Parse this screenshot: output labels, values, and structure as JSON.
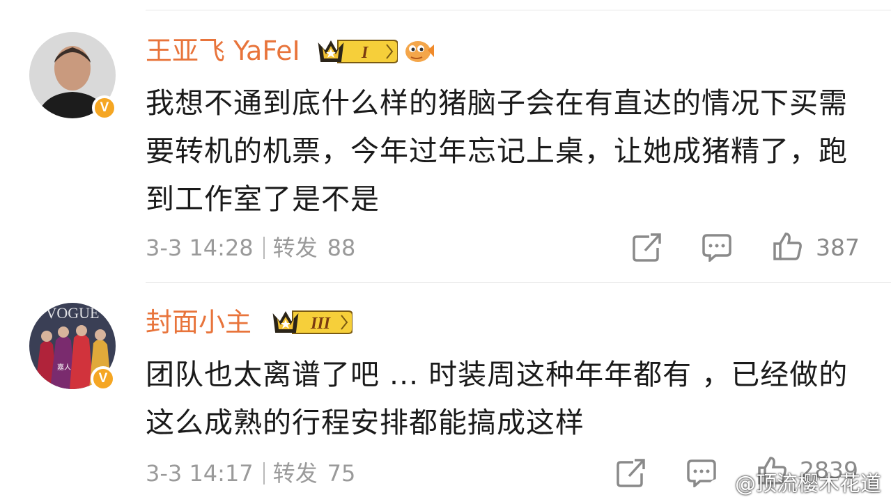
{
  "comments": [
    {
      "username": "王亚飞 YaFeI",
      "level": "I",
      "text": "我想不通到底什么样的猪脑子会在有直达的情况下买需要转机的机票，今年过年忘记上桌，让她成猪精了，跑到工作室了是不是",
      "time": "3-3 14:28",
      "repost_label": "转发",
      "repost_count": "88",
      "like_count": "387"
    },
    {
      "username": "封面小主",
      "level": "III",
      "text": "团队也太离谱了吧 ... 时装周这种年年都有 ，已经做的这么成熟的行程安排都能搞成这样",
      "time": "3-3 14:17",
      "repost_label": "转发",
      "repost_count": "75",
      "like_count": "2839"
    }
  ],
  "watermark": "@顶流樱木花道",
  "icons": [
    "verified-v-icon",
    "crown-level-icon",
    "puffer-fish-icon",
    "share-icon",
    "comment-icon",
    "like-icon",
    "weibo-logo-icon"
  ],
  "colors": {
    "username": "#e8743b",
    "verified": "#f5a623",
    "crown": "#f2c12e",
    "meta": "#9a9a9a"
  }
}
